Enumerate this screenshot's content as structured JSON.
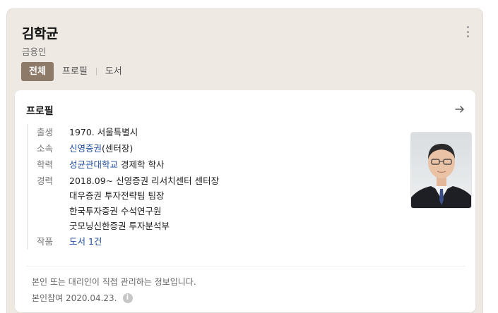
{
  "profile": {
    "name": "김학균",
    "job": "금융인"
  },
  "tabs": [
    {
      "label": "전체"
    },
    {
      "label": "프로필"
    },
    {
      "label": "도서"
    }
  ],
  "card": {
    "title": "프로필",
    "rows": {
      "birth": {
        "label": "출생",
        "value": "1970. 서울특별시"
      },
      "affiliation": {
        "label": "소속",
        "link": "신영증권",
        "suffix": "(센터장)"
      },
      "education": {
        "label": "학력",
        "link": "성균관대학교",
        "suffix": " 경제학 학사"
      },
      "career": {
        "label": "경력",
        "lines": [
          "2018.09~ 신영증권 리서치센터 센터장",
          "대우증권 투자전략팀 팀장",
          "한국투자증권 수석연구원",
          "굿모닝신한증권 투자분석부"
        ]
      },
      "works": {
        "label": "작품",
        "link": "도서 1건"
      }
    },
    "note": "본인 또는 대리인이 직접 관리하는 정보입니다.",
    "verified": "본인참여 2020.04.23.",
    "info_icon": "i"
  },
  "icons": {
    "more": "more-vertical-icon",
    "arrow": "arrow-right-icon",
    "info": "info-icon"
  },
  "colors": {
    "accent": "#8e7a69",
    "link": "#1f4c9c",
    "panel_bg": "#efe9e4"
  }
}
